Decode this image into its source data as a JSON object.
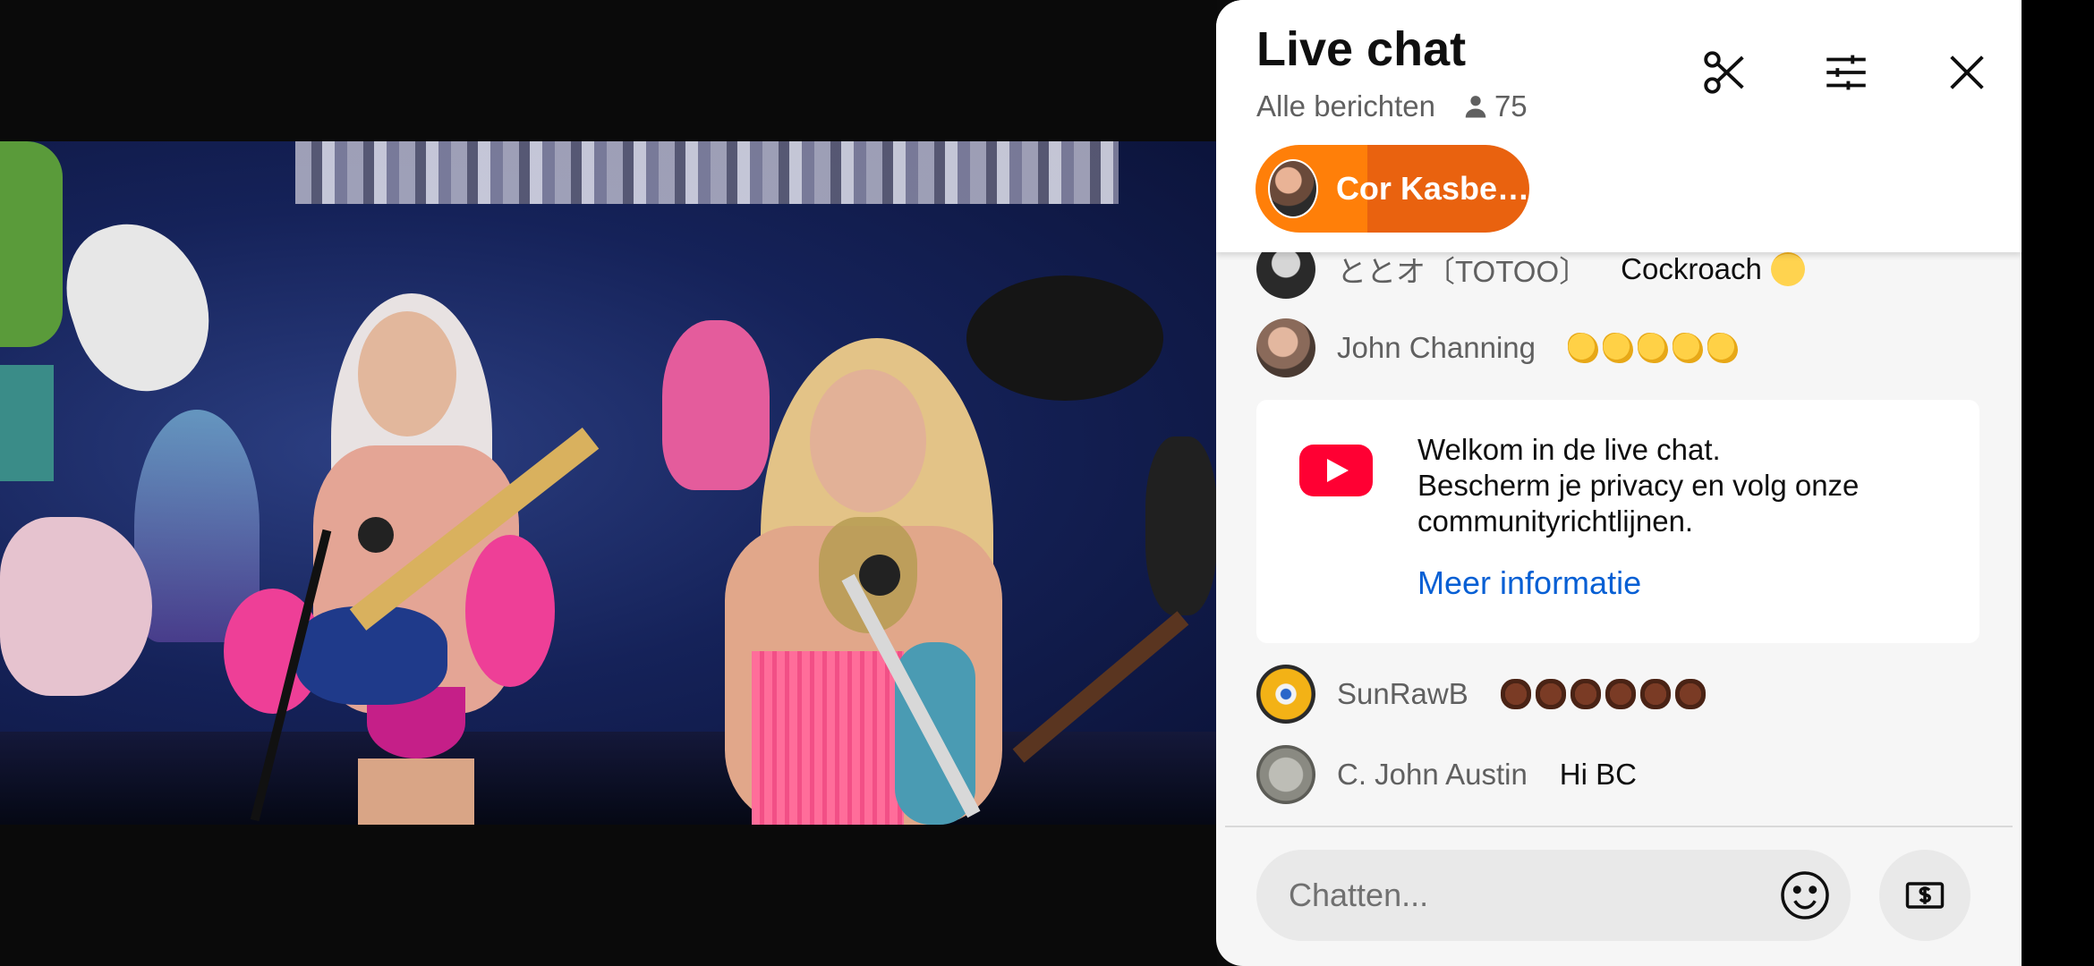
{
  "video": {
    "description_icon": "live-video"
  },
  "chat": {
    "title": "Live chat",
    "filter_label": "Alle berichten",
    "viewer_count": "75",
    "pinned": {
      "label": "Cor Kasbe…"
    },
    "messages": [
      {
        "author": "ととオ〔TOTOO〕",
        "text": "Cockroach",
        "emoji": "face-with-rolling-eyes"
      },
      {
        "author": "John Channing",
        "text": "",
        "emoji": "clapping-hands",
        "emoji_count": 5
      },
      {
        "author": "SunRawB",
        "text": "",
        "emoji": "cockroach",
        "emoji_count": 6
      },
      {
        "author": "C. John Austin",
        "text": "Hi BC"
      }
    ],
    "welcome": {
      "line1": "Welkom in de live chat.",
      "line2": "Bescherm je privacy en volg onze communityrichtlijnen.",
      "link": "Meer informatie"
    },
    "input": {
      "placeholder": "Chatten..."
    }
  },
  "colors": {
    "accent_orange": "#ff7f09",
    "link_blue": "#065fd4",
    "youtube_red": "#ff0033"
  }
}
